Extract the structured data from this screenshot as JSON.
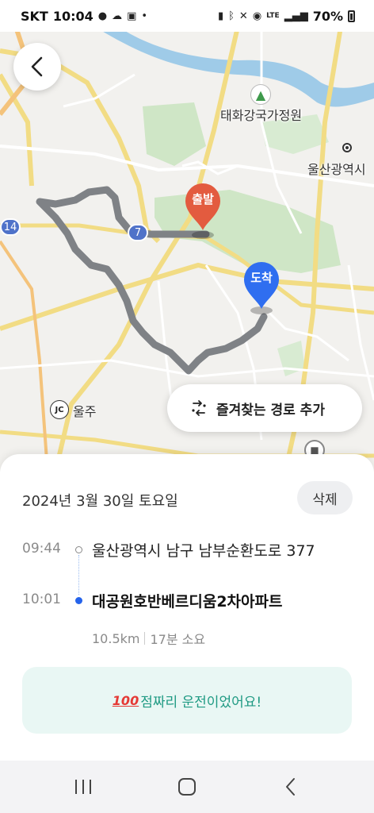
{
  "status_bar": {
    "carrier": "SKT",
    "time": "10:04",
    "battery": "70%",
    "network": "LTE"
  },
  "map": {
    "place_labels": {
      "garden": "태화강국가정원",
      "city": "울산광역시",
      "junction": "울주"
    },
    "road_shields": {
      "r14": "14",
      "r7": "7"
    },
    "junction_badge": "JC",
    "pins": {
      "start": {
        "label": "출발",
        "color": "#e35b3f"
      },
      "end": {
        "label": "도착",
        "color": "#2f6ef0"
      }
    },
    "favorite_button": "즐겨찾는 경로 추가"
  },
  "sheet": {
    "date": "2024년 3월 30일 토요일",
    "delete_label": "삭제",
    "origin_time": "09:44",
    "origin": "울산광역시 남구 남부순환도로 377",
    "dest_time": "10:01",
    "destination": "대공원호반베르디움2차아파트",
    "distance": "10.5km",
    "duration": "17분 소요",
    "banner_badge": "100",
    "banner_text": "점짜리 운전이었어요!"
  },
  "icons": {
    "back": "chevron-left-icon",
    "route": "route-swap-icon",
    "garden": "tree-icon",
    "city": "city-dot-icon",
    "nav_recents": "recents-icon",
    "nav_home": "home-icon",
    "nav_back": "back-icon"
  },
  "colors": {
    "route": "#7f8286",
    "accent_blue": "#2563eb",
    "banner_bg": "#e9f7f4",
    "banner_text": "#1f9a83"
  }
}
